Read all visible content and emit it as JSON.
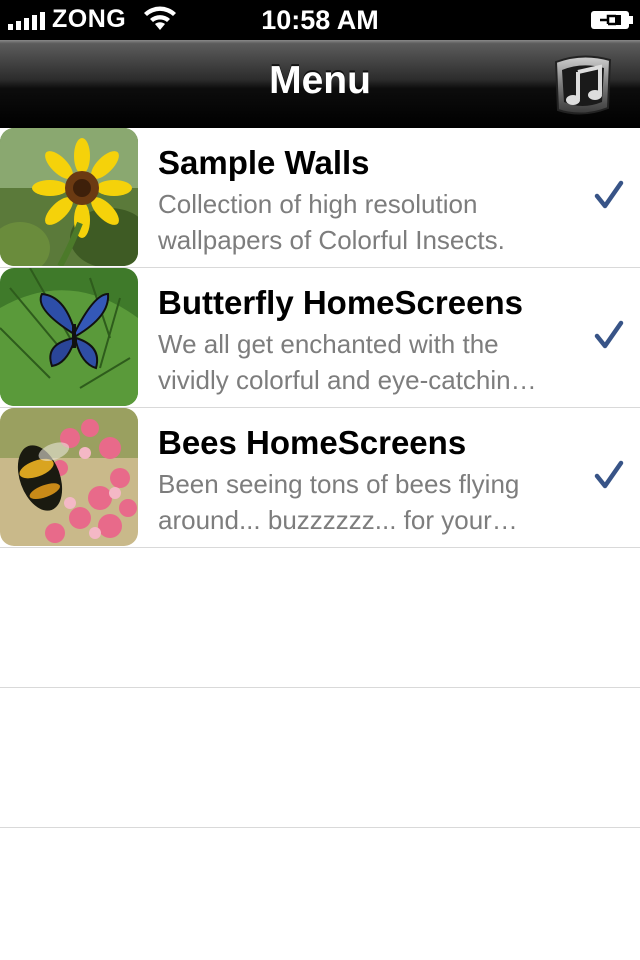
{
  "status_bar": {
    "carrier": "ZONG",
    "time": "10:58 AM"
  },
  "nav_bar": {
    "title": "Menu",
    "right_icon": "music-note-icon"
  },
  "rows": [
    {
      "title": "Sample Walls",
      "description": "Collection of high resolution\nwallpapers of Colorful Insects.",
      "thumbnail": "sunflower-image",
      "accessory": "checkmark-icon"
    },
    {
      "title": "Butterfly HomeScreens",
      "description": " We all get enchanted with the\nvividly colorful and eye-catchin…",
      "thumbnail": "butterfly-image",
      "accessory": "checkmark-icon"
    },
    {
      "title": "Bees HomeScreens",
      "description": "Been seeing tons of bees flying\naround... buzzzzzz... for your…",
      "thumbnail": "bee-image",
      "accessory": "checkmark-icon"
    }
  ],
  "colors": {
    "checkmark": "#385487",
    "description": "#7d7d7d",
    "separator": "#d9d9d9"
  }
}
